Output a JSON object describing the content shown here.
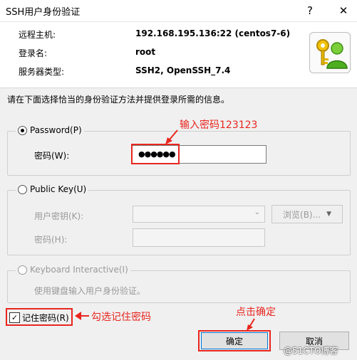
{
  "window": {
    "title": "SSH用户身份验证",
    "help_glyph": "?",
    "close_glyph": "✕"
  },
  "info": {
    "host_label": "远程主机:",
    "host_value": "192.168.195.136:22 (centos7-6)",
    "login_label": "登录名:",
    "login_value": "root",
    "server_label": "服务器类型:",
    "server_value": "SSH2, OpenSSH_7.4"
  },
  "prompt": "请在下面选择恰当的身份验证方法并提供登录所需的信息。",
  "password_group": {
    "label": "Password(P)",
    "field_label": "密码(W):",
    "value": "●●●●●●",
    "selected": true
  },
  "pubkey_group": {
    "label": "Public Key(U)",
    "user_key_label": "用户密钥(K):",
    "browse_label": "浏览(B)...",
    "passphrase_label": "密码(H):"
  },
  "keyboard_group": {
    "label": "Keyboard Interactive(I)",
    "description": "使用键盘输入用户身份验证。"
  },
  "remember": {
    "label": "记住密码(R)",
    "checked": true
  },
  "buttons": {
    "ok": "确定",
    "cancel": "取消"
  },
  "annotations": {
    "password_note": "输入密码123123",
    "remember_note": "勾选记住密码",
    "ok_note": "点击确定",
    "watermark": "@51CTO博客"
  },
  "colors": {
    "annotation": "#e8261f"
  }
}
